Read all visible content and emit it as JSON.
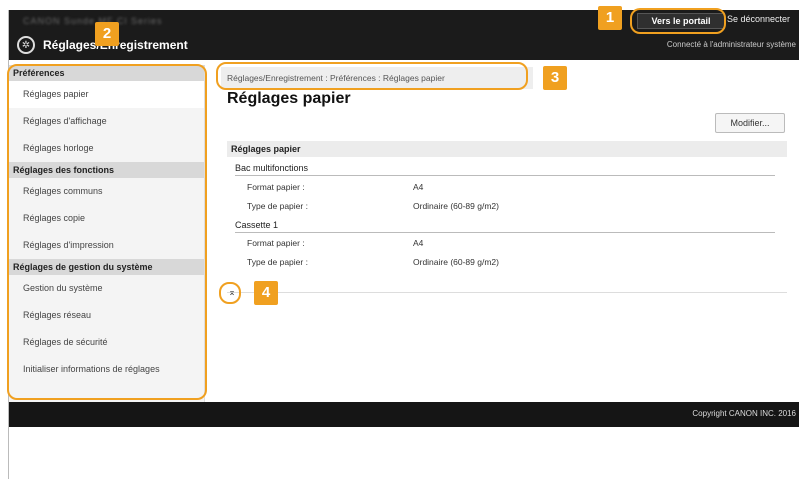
{
  "header": {
    "blurred_text": "CANON   Sunde   MF Cl   Series",
    "portal_label": "Vers le portail",
    "logout_label": "Se déconnecter",
    "admin_note": "Connecté à l'administrateur système",
    "app_title": "Réglages/Enregistrement"
  },
  "sidebar": {
    "sections": [
      {
        "title": "Préférences",
        "items": [
          "Réglages papier",
          "Réglages d'affichage",
          "Réglages horloge"
        ]
      },
      {
        "title": "Réglages des fonctions",
        "items": [
          "Réglages communs",
          "Réglages copie",
          "Réglages d'impression"
        ]
      },
      {
        "title": "Réglages de gestion du système",
        "items": [
          "Gestion du système",
          "Réglages réseau",
          "Réglages de sécurité",
          "Initialiser informations de réglages"
        ]
      }
    ]
  },
  "main": {
    "breadcrumb": "Réglages/Enregistrement : Préférences : Réglages papier",
    "title": "Réglages papier",
    "modify_label": "Modifier...",
    "section_title": "Réglages papier",
    "groups": [
      {
        "title": "Bac multifonctions",
        "rows": [
          {
            "label": "Format papier :",
            "value": "A4"
          },
          {
            "label": "Type de papier :",
            "value": "Ordinaire (60-89 g/m2)"
          }
        ]
      },
      {
        "title": "Cassette 1",
        "rows": [
          {
            "label": "Format papier :",
            "value": "A4"
          },
          {
            "label": "Type de papier :",
            "value": "Ordinaire (60-89 g/m2)"
          }
        ]
      }
    ],
    "top_icon": "⌅"
  },
  "footer": {
    "copyright": "Copyright CANON INC. 2016"
  },
  "callouts": [
    "1",
    "2",
    "3",
    "4"
  ]
}
